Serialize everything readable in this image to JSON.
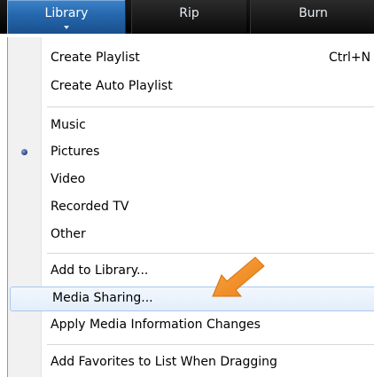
{
  "toolbar": {
    "tabs": [
      {
        "label": "Library"
      },
      {
        "label": "Rip"
      },
      {
        "label": "Burn"
      }
    ]
  },
  "menu": {
    "create_playlist": {
      "label": "Create Playlist",
      "shortcut": "Ctrl+N"
    },
    "create_auto_playlist": {
      "label": "Create Auto Playlist"
    },
    "music": {
      "label": "Music"
    },
    "pictures": {
      "label": "Pictures",
      "selected": true
    },
    "video": {
      "label": "Video"
    },
    "recorded_tv": {
      "label": "Recorded TV"
    },
    "other": {
      "label": "Other"
    },
    "add_to_library": {
      "label": "Add to Library..."
    },
    "media_sharing": {
      "label": "Media Sharing...",
      "highlighted": true
    },
    "apply_media_info": {
      "label": "Apply Media Information Changes"
    },
    "add_favorites": {
      "label": "Add Favorites to List When Dragging"
    }
  },
  "annotation": {
    "icon": "pointer-arrow-icon",
    "color": "#f39322"
  },
  "colors": {
    "tab_active": "#2567ad",
    "toolbar": "#000000",
    "highlight_border": "#a8c8ea"
  }
}
